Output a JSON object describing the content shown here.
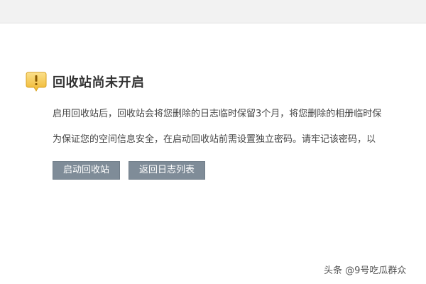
{
  "notice": {
    "icon": "warning-icon",
    "title": "回收站尚未开启",
    "paragraph1": "启用回收站后，回收站会将您删除的日志临时保留3个月，将您删除的相册临时保",
    "paragraph2": "为保证您的空间信息安全，在启动回收站前需设置独立密码。请牢记该密码，以"
  },
  "buttons": {
    "enable_label": "启动回收站",
    "back_label": "返回日志列表"
  },
  "watermark": {
    "text": "头条 @9号吃瓜群众"
  },
  "colors": {
    "button_bg": "#7f8c98",
    "icon_bg": "#f5c84a",
    "topbar_bg": "#f2f2f2"
  }
}
